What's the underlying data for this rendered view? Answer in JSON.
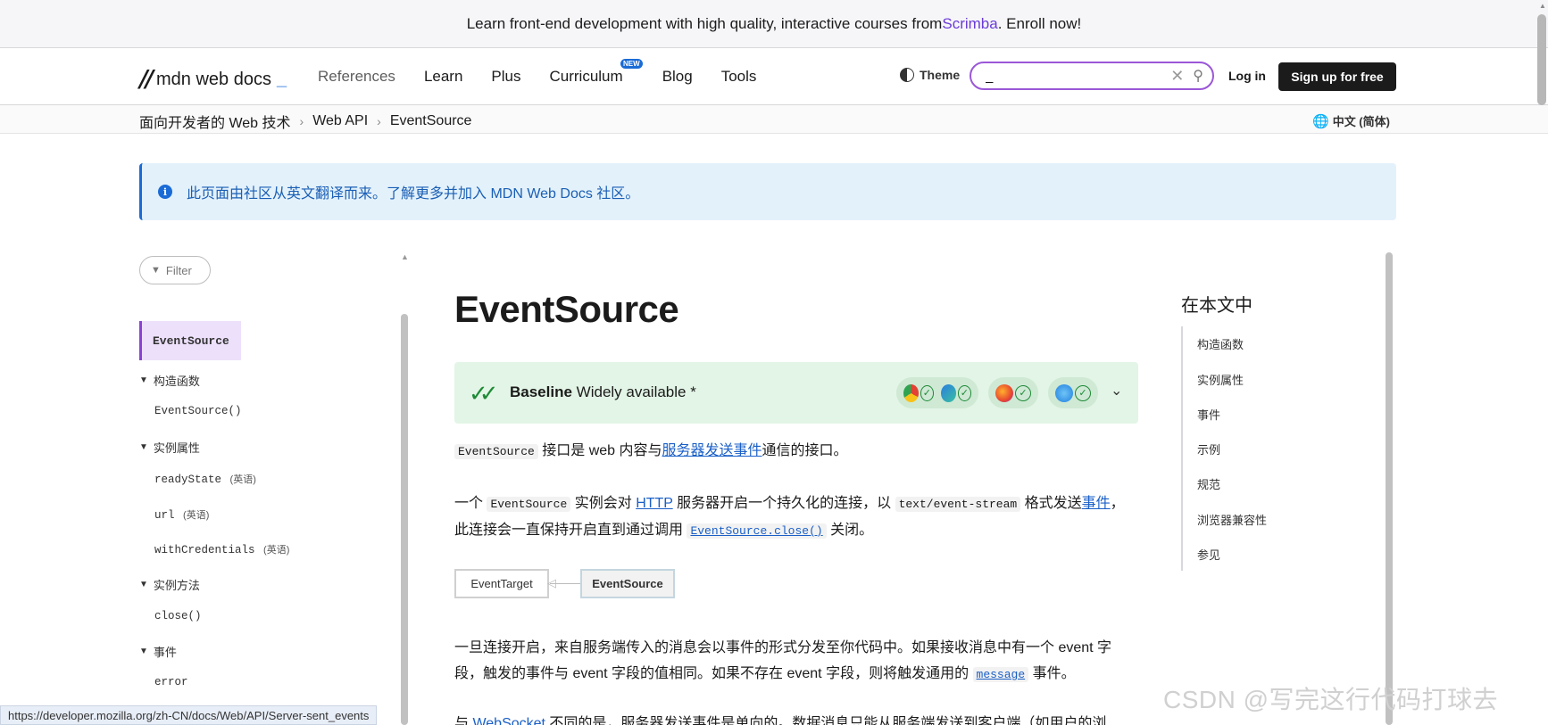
{
  "banner": {
    "prefix": "Learn front-end development with high quality, interactive courses from ",
    "brand": "Scrimba",
    "suffix": ". Enroll now!"
  },
  "header": {
    "logo_text": "mdn web docs",
    "logo_caret": "_",
    "nav": [
      {
        "label": "References"
      },
      {
        "label": "Learn"
      },
      {
        "label": "Plus"
      },
      {
        "label": "Curriculum",
        "badge": "NEW"
      },
      {
        "label": "Blog"
      },
      {
        "label": "Tools"
      }
    ],
    "theme_label": "Theme",
    "search_value": "_",
    "login_label": "Log in",
    "signup_label": "Sign up for free"
  },
  "breadcrumbs": [
    "面向开发者的 Web 技术",
    "Web API",
    "EventSource"
  ],
  "language": "中文 (简体)",
  "notice": {
    "text": "此页面由社区从英文翻译而来。了解更多并加入 MDN Web Docs 社区。"
  },
  "sidebar": {
    "filter_label": "Filter",
    "active": "EventSource",
    "groups": [
      {
        "label": "构造函数",
        "items": [
          {
            "label": "EventSource()",
            "tag": ""
          }
        ]
      },
      {
        "label": "实例属性",
        "items": [
          {
            "label": "readyState",
            "tag": "(英语)"
          },
          {
            "label": "url",
            "tag": "(英语)"
          },
          {
            "label": "withCredentials",
            "tag": "(英语)"
          }
        ]
      },
      {
        "label": "实例方法",
        "items": [
          {
            "label": "close()",
            "tag": ""
          }
        ]
      },
      {
        "label": "事件",
        "items": [
          {
            "label": "error",
            "tag": ""
          }
        ]
      }
    ]
  },
  "article": {
    "title": "EventSource",
    "baseline": {
      "strong": "Baseline",
      "rest": " Widely available *"
    },
    "p1": {
      "code": "EventSource",
      "t1": " 接口是 web 内容与",
      "link": "服务器发送事件",
      "t2": "通信的接口。"
    },
    "p2": {
      "t1": "一个 ",
      "code1": "EventSource",
      "t2": " 实例会对 ",
      "link1": "HTTP",
      "t3": " 服务器开启一个持久化的连接，以 ",
      "code2": "text/event-stream",
      "t4": " 格式发送",
      "link2": "事件",
      "t5": "，此连接会一直保持开启直到通过调用 ",
      "code_link": "EventSource.close()",
      "t6": " 关闭。"
    },
    "inheritance": {
      "parent": "EventTarget",
      "child": "EventSource"
    },
    "p3": {
      "t1": "一旦连接开启，来自服务端传入的消息会以事件的形式分发至你代码中。如果接收消息中有一个 event 字段，触发的事件与 event 字段的值相同。如果不存在 event 字段，则将触发通用的 ",
      "code_link": "message",
      "t2": " 事件。"
    },
    "p4": {
      "t1": "与 ",
      "link": "WebSocket",
      "t2": " 不同的是，服务器发送事件是单向的。数据消息只能从服务端发送到客户端（如用户的浏"
    }
  },
  "toc": {
    "title": "在本文中",
    "items": [
      "构造函数",
      "实例属性",
      "事件",
      "示例",
      "规范",
      "浏览器兼容性",
      "参见"
    ]
  },
  "status_url": "https://developer.mozilla.org/zh-CN/docs/Web/API/Server-sent_events",
  "watermark": "CSDN @写完这行代码打球去",
  "colors": {
    "accent": "#8a42d4",
    "link": "#1a5fc7",
    "baseline_bg": "#e3f5e6",
    "notice_bg": "#e3f1fb"
  },
  "icons": [
    "theme-icon",
    "search-icon",
    "clear-icon",
    "globe-icon",
    "info-icon",
    "filter-icon",
    "chevron-down-icon",
    "baseline-check-icon"
  ]
}
